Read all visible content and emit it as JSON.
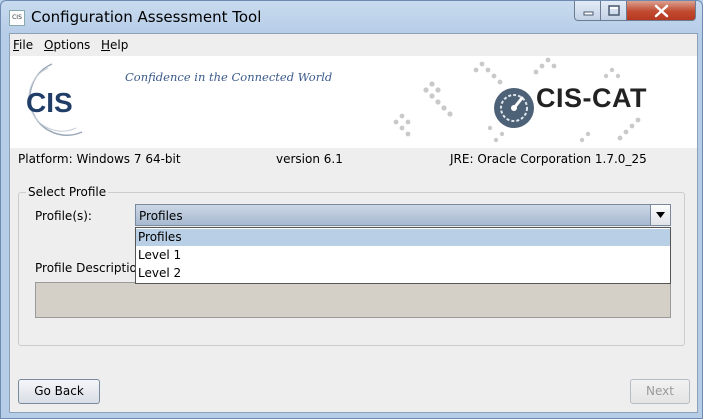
{
  "window": {
    "icon_text": "CIS",
    "title": "Configuration Assessment Tool"
  },
  "menu": {
    "file": {
      "first": "F",
      "rest": "ile"
    },
    "options": {
      "first": "O",
      "rest": "ptions"
    },
    "help": {
      "first": "H",
      "rest": "elp"
    }
  },
  "banner": {
    "logo_text": "CIS",
    "tagline": "Confidence in the Connected World",
    "product_logo_text": "CIS-CAT"
  },
  "info": {
    "platform_label": "Platform:",
    "platform_value": "Windows 7 64-bit",
    "version_label": "version",
    "version_value": "6.1",
    "jre_label": "JRE:",
    "jre_value": "Oracle Corporation 1.7.0_25"
  },
  "select_profile": {
    "group_title": "Select Profile",
    "profiles_label": "Profile(s):",
    "selected_value": "Profiles",
    "options": [
      "Profiles",
      "Level 1",
      "Level 2"
    ],
    "highlighted_index": 0,
    "description_label": "Profile Description"
  },
  "buttons": {
    "back": "Go Back",
    "next": "Next"
  },
  "colors": {
    "titlebar": "#b6cde8",
    "close_button": "#c14a2f",
    "dropdown_highlight": "#b8cfe5",
    "combo_fill": "#a7b9d0",
    "tagline": "#3a5a8a"
  }
}
